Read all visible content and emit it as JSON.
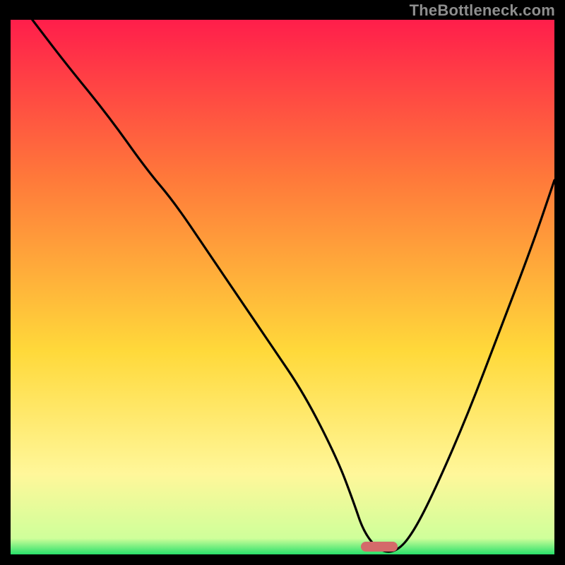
{
  "watermark": "TheBottleneck.com",
  "colors": {
    "gradient_top": "#ff1e4b",
    "gradient_mid1": "#ff7a3a",
    "gradient_mid2": "#ffd93a",
    "gradient_mid3": "#fff79a",
    "gradient_bottom": "#28e06a",
    "marker": "#d46a6a",
    "curve": "#000000",
    "frame": "#000000"
  },
  "marker": {
    "x_frac": 0.678,
    "width_frac": 0.068,
    "y_frac": 0.985
  },
  "chart_data": {
    "type": "line",
    "title": "",
    "xlabel": "",
    "ylabel": "",
    "xlim": [
      0,
      100
    ],
    "ylim": [
      0,
      100
    ],
    "annotations": [
      "TheBottleneck.com"
    ],
    "legend": false,
    "grid": false,
    "optimum_x": 68,
    "series": [
      {
        "name": "bottleneck-curve",
        "x": [
          4,
          10,
          18,
          25,
          30,
          36,
          42,
          48,
          54,
          60,
          63,
          65,
          68,
          71,
          74,
          78,
          84,
          90,
          96,
          100
        ],
        "y": [
          100,
          92,
          82,
          72,
          66,
          57,
          48,
          39,
          30,
          18,
          10,
          4,
          0.5,
          0.5,
          4,
          12,
          26,
          42,
          58,
          70
        ]
      }
    ],
    "background_gradient": {
      "direction": "vertical",
      "stops": [
        {
          "pos": 0.0,
          "color": "#ff1e4b"
        },
        {
          "pos": 0.3,
          "color": "#ff7a3a"
        },
        {
          "pos": 0.62,
          "color": "#ffd93a"
        },
        {
          "pos": 0.85,
          "color": "#fff79a"
        },
        {
          "pos": 0.97,
          "color": "#cfff9a"
        },
        {
          "pos": 1.0,
          "color": "#28e06a"
        }
      ]
    }
  }
}
